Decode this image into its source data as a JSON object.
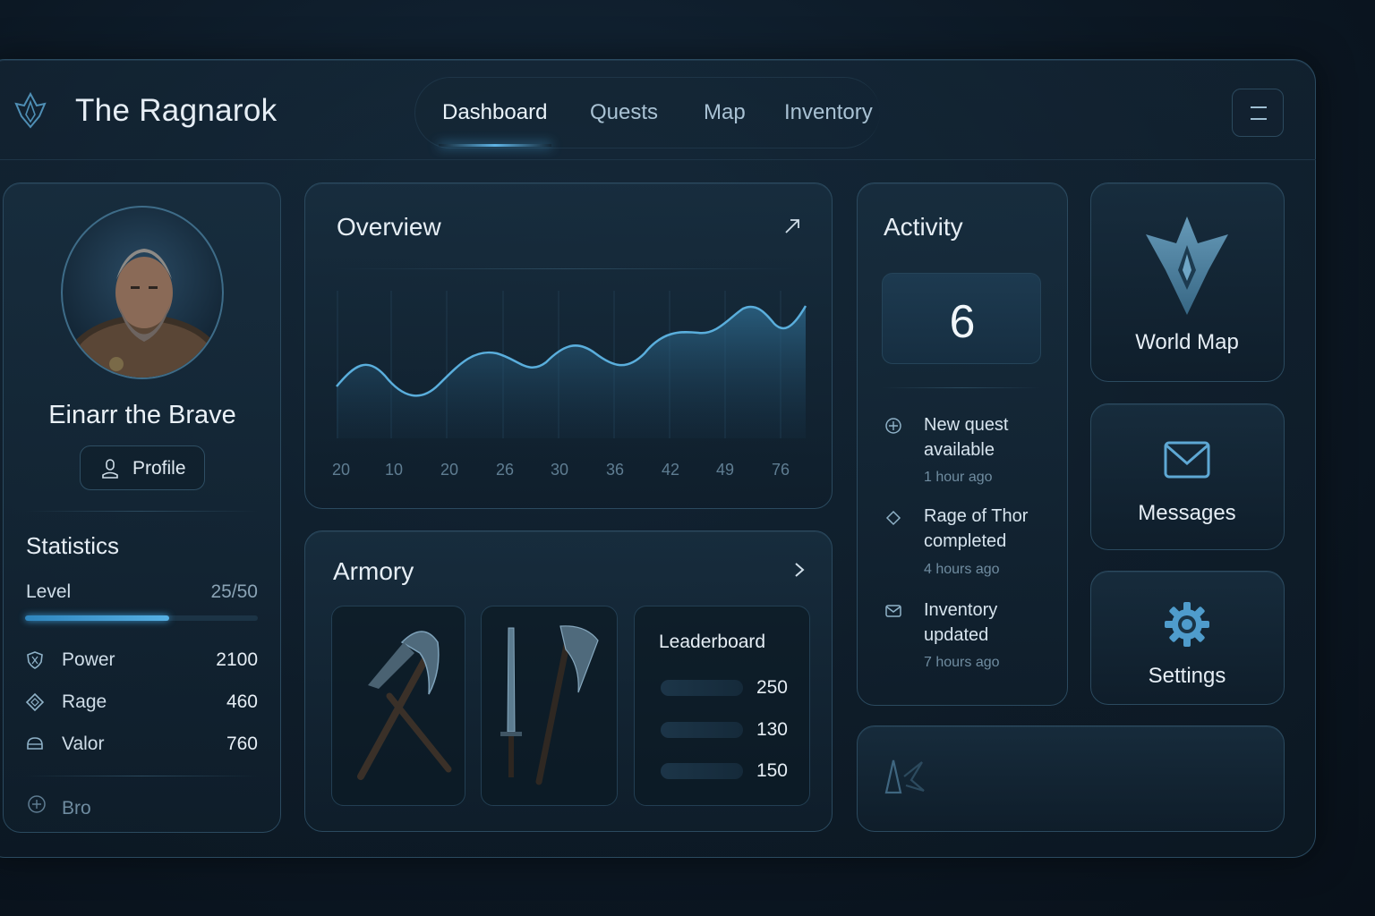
{
  "app": {
    "title": "The Ragnarok"
  },
  "nav": {
    "items": [
      {
        "label": "Dashboard",
        "active": true
      },
      {
        "label": "Quests",
        "active": false
      },
      {
        "label": "Map",
        "active": false
      },
      {
        "label": "Inventory",
        "active": false
      }
    ],
    "menu_icon": "menu-icon"
  },
  "profile": {
    "name": "Einarr the Brave",
    "button_label": "Profile",
    "avatar_icon": "warrior-portrait"
  },
  "statistics": {
    "title": "Statistics",
    "level_label": "Level",
    "level_value": "25/50",
    "level_progress": 0.5,
    "items": [
      {
        "label": "Power",
        "value": "2100",
        "icon": "shield-icon"
      },
      {
        "label": "Rage",
        "value": "460",
        "icon": "diamond-icon"
      },
      {
        "label": "Valor",
        "value": "760",
        "icon": "helmet-icon"
      }
    ],
    "footer_label": "Bro"
  },
  "overview": {
    "title": "Overview",
    "expand_icon": "arrow-up-right-icon",
    "x_ticks": [
      "20",
      "10",
      "20",
      "26",
      "30",
      "36",
      "42",
      "49",
      "76"
    ]
  },
  "armory": {
    "title": "Armory",
    "chevron_icon": "chevron-right-icon",
    "slots": [
      "pickaxe-icon",
      "sword-and-axe-icon"
    ],
    "leaderboard": {
      "title": "Leaderboard",
      "rows": [
        "250",
        "130",
        "150"
      ]
    }
  },
  "activity": {
    "title": "Activity",
    "count": "6",
    "items": [
      {
        "text": "New quest available",
        "time": "1 hour ago",
        "icon": "plus-circle-icon"
      },
      {
        "text": "Rage of Thor completed",
        "time": "4 hours ago",
        "icon": "diamond-icon"
      },
      {
        "text": "Inventory updated",
        "time": "7 hours ago",
        "icon": "mail-icon"
      }
    ]
  },
  "tiles": {
    "world_map": "World Map",
    "messages": "Messages",
    "settings": "Settings"
  },
  "colors": {
    "accent": "#56b0e4",
    "background": "#0c1824",
    "card_border": "#2b4a5f"
  }
}
